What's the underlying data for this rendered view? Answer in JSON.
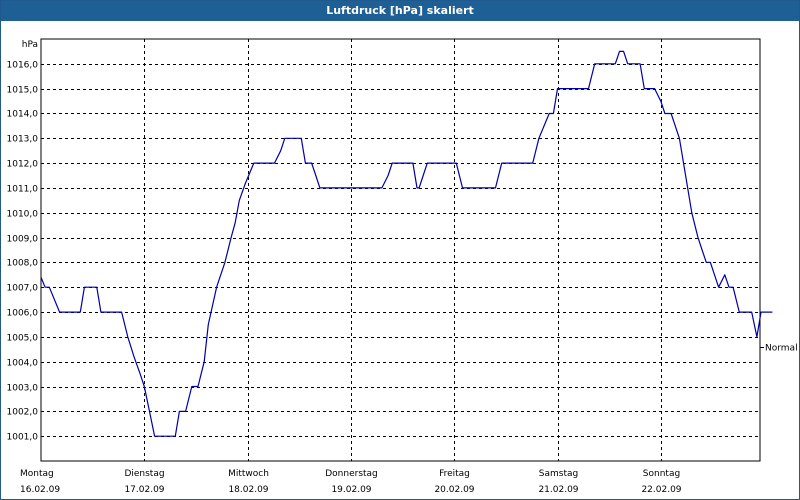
{
  "window": {
    "title": "Luftdruck [hPa] skaliert"
  },
  "chart_data": {
    "type": "line",
    "title": "Luftdruck [hPa] skaliert",
    "ylabel": "hPa",
    "ylim": [
      1000.0,
      1017.0
    ],
    "yticks": [
      1001,
      1002,
      1003,
      1004,
      1005,
      1006,
      1007,
      1008,
      1009,
      1010,
      1011,
      1012,
      1013,
      1014,
      1015,
      1016
    ],
    "ytick_labels": [
      "1001,0",
      "1002,0",
      "1003,0",
      "1004,0",
      "1005,0",
      "1006,0",
      "1007,0",
      "1008,0",
      "1009,0",
      "1010,0",
      "1011,0",
      "1012,0",
      "1013,0",
      "1014,0",
      "1015,0",
      "1016,0"
    ],
    "xlim": [
      0,
      7
    ],
    "x_ticks": [
      {
        "x": 0,
        "day": "Montag",
        "date": "16.02.09"
      },
      {
        "x": 1,
        "day": "Dienstag",
        "date": "17.02.09"
      },
      {
        "x": 2,
        "day": "Mittwoch",
        "date": "18.02.09"
      },
      {
        "x": 3,
        "day": "Donnerstag",
        "date": "19.02.09"
      },
      {
        "x": 4,
        "day": "Freitag",
        "date": "20.02.09"
      },
      {
        "x": 5,
        "day": "Samstag",
        "date": "21.02.09"
      },
      {
        "x": 6,
        "day": "Sonntag",
        "date": "22.02.09"
      }
    ],
    "reference": {
      "label": "Normal",
      "value": 1004.6
    },
    "grid": true,
    "series": [
      {
        "color": "#0000aa",
        "points": [
          [
            0.0,
            1007.4
          ],
          [
            0.04,
            1007.0
          ],
          [
            0.08,
            1007.0
          ],
          [
            0.18,
            1006.0
          ],
          [
            0.38,
            1006.0
          ],
          [
            0.42,
            1007.0
          ],
          [
            0.54,
            1007.0
          ],
          [
            0.58,
            1006.0
          ],
          [
            0.78,
            1006.0
          ],
          [
            0.84,
            1005.0
          ],
          [
            0.9,
            1004.2
          ],
          [
            0.96,
            1003.5
          ],
          [
            1.0,
            1003.0
          ],
          [
            1.05,
            1002.0
          ],
          [
            1.1,
            1001.0
          ],
          [
            1.14,
            1001.0
          ],
          [
            1.3,
            1001.0
          ],
          [
            1.34,
            1002.0
          ],
          [
            1.4,
            1002.0
          ],
          [
            1.46,
            1003.0
          ],
          [
            1.52,
            1003.0
          ],
          [
            1.58,
            1004.0
          ],
          [
            1.62,
            1005.5
          ],
          [
            1.7,
            1007.0
          ],
          [
            1.78,
            1008.0
          ],
          [
            1.84,
            1009.0
          ],
          [
            1.88,
            1009.6
          ],
          [
            1.92,
            1010.5
          ],
          [
            1.98,
            1011.2
          ],
          [
            2.02,
            1011.6
          ],
          [
            2.06,
            1012.0
          ],
          [
            2.26,
            1012.0
          ],
          [
            2.32,
            1012.5
          ],
          [
            2.36,
            1013.0
          ],
          [
            2.52,
            1013.0
          ],
          [
            2.56,
            1012.0
          ],
          [
            2.62,
            1012.0
          ],
          [
            2.66,
            1011.5
          ],
          [
            2.7,
            1011.0
          ],
          [
            3.3,
            1011.0
          ],
          [
            3.36,
            1011.5
          ],
          [
            3.4,
            1012.0
          ],
          [
            3.6,
            1012.0
          ],
          [
            3.64,
            1011.0
          ],
          [
            3.66,
            1011.0
          ],
          [
            3.7,
            1011.5
          ],
          [
            3.74,
            1012.0
          ],
          [
            4.02,
            1012.0
          ],
          [
            4.08,
            1011.0
          ],
          [
            4.4,
            1011.0
          ],
          [
            4.46,
            1012.0
          ],
          [
            4.76,
            1012.0
          ],
          [
            4.82,
            1013.0
          ],
          [
            4.88,
            1013.6
          ],
          [
            4.92,
            1014.0
          ],
          [
            4.96,
            1014.0
          ],
          [
            5.0,
            1015.0
          ],
          [
            5.3,
            1015.0
          ],
          [
            5.36,
            1016.0
          ],
          [
            5.56,
            1016.0
          ],
          [
            5.6,
            1016.5
          ],
          [
            5.64,
            1016.5
          ],
          [
            5.68,
            1016.0
          ],
          [
            5.8,
            1016.0
          ],
          [
            5.84,
            1015.0
          ],
          [
            5.94,
            1015.0
          ],
          [
            6.0,
            1014.5
          ],
          [
            6.04,
            1014.0
          ],
          [
            6.1,
            1014.0
          ],
          [
            6.18,
            1013.0
          ],
          [
            6.24,
            1011.5
          ],
          [
            6.3,
            1010.0
          ],
          [
            6.36,
            1009.0
          ],
          [
            6.4,
            1008.5
          ],
          [
            6.44,
            1008.0
          ],
          [
            6.48,
            1008.0
          ],
          [
            6.52,
            1007.5
          ],
          [
            6.56,
            1007.0
          ],
          [
            6.62,
            1007.5
          ],
          [
            6.66,
            1007.0
          ],
          [
            6.7,
            1007.0
          ],
          [
            6.76,
            1006.0
          ],
          [
            6.88,
            1006.0
          ],
          [
            6.93,
            1005.0
          ],
          [
            6.97,
            1006.0
          ],
          [
            7.08,
            1006.0
          ]
        ]
      }
    ]
  }
}
